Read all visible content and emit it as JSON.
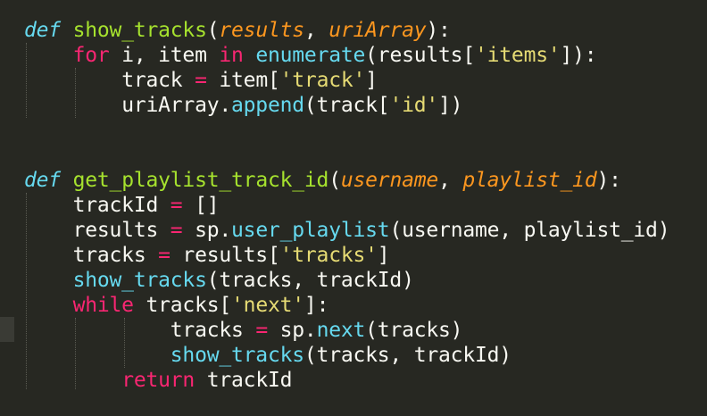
{
  "editor": {
    "language": "python",
    "theme": "monokai",
    "colors": {
      "background": "#272822",
      "keyword_def": "#66d9ef",
      "keyword_control": "#f92672",
      "function_name": "#a6e22e",
      "parameter": "#fd971f",
      "string": "#e6db74",
      "builtin_call": "#66d9ef",
      "plain": "#f8f8f2"
    },
    "lines": [
      {
        "indent": "",
        "tokens": [
          {
            "t": "def",
            "c": "kw"
          },
          {
            "t": " ",
            "c": "pl"
          },
          {
            "t": "show_tracks",
            "c": "fn"
          },
          {
            "t": "(",
            "c": "pl"
          },
          {
            "t": "results",
            "c": "par"
          },
          {
            "t": ", ",
            "c": "pl"
          },
          {
            "t": "uriArray",
            "c": "par"
          },
          {
            "t": "):",
            "c": "pl"
          }
        ]
      },
      {
        "indent": "    ",
        "tokens": [
          {
            "t": "for",
            "c": "ctl"
          },
          {
            "t": " i, item ",
            "c": "pl"
          },
          {
            "t": "in",
            "c": "ctl"
          },
          {
            "t": " ",
            "c": "pl"
          },
          {
            "t": "enumerate",
            "c": "bi"
          },
          {
            "t": "(results[",
            "c": "pl"
          },
          {
            "t": "'items'",
            "c": "str"
          },
          {
            "t": "]):",
            "c": "pl"
          }
        ]
      },
      {
        "indent": "        ",
        "tokens": [
          {
            "t": "track ",
            "c": "pl"
          },
          {
            "t": "=",
            "c": "op"
          },
          {
            "t": " item[",
            "c": "pl"
          },
          {
            "t": "'track'",
            "c": "str"
          },
          {
            "t": "]",
            "c": "pl"
          }
        ]
      },
      {
        "indent": "        ",
        "tokens": [
          {
            "t": "uriArray.",
            "c": "pl"
          },
          {
            "t": "append",
            "c": "bi"
          },
          {
            "t": "(track[",
            "c": "pl"
          },
          {
            "t": "'id'",
            "c": "str"
          },
          {
            "t": "])",
            "c": "pl"
          }
        ]
      },
      {
        "indent": "",
        "tokens": []
      },
      {
        "indent": "",
        "tokens": []
      },
      {
        "indent": "",
        "tokens": [
          {
            "t": "def",
            "c": "kw"
          },
          {
            "t": " ",
            "c": "pl"
          },
          {
            "t": "get_playlist_track_id",
            "c": "fn"
          },
          {
            "t": "(",
            "c": "pl"
          },
          {
            "t": "username",
            "c": "par"
          },
          {
            "t": ", ",
            "c": "pl"
          },
          {
            "t": "playlist_id",
            "c": "par"
          },
          {
            "t": "):",
            "c": "pl"
          }
        ]
      },
      {
        "indent": "    ",
        "tokens": [
          {
            "t": "trackId ",
            "c": "pl"
          },
          {
            "t": "=",
            "c": "op"
          },
          {
            "t": " []",
            "c": "pl"
          }
        ]
      },
      {
        "indent": "    ",
        "tokens": [
          {
            "t": "results ",
            "c": "pl"
          },
          {
            "t": "=",
            "c": "op"
          },
          {
            "t": " sp.",
            "c": "pl"
          },
          {
            "t": "user_playlist",
            "c": "bi"
          },
          {
            "t": "(username, playlist_id)",
            "c": "pl"
          }
        ]
      },
      {
        "indent": "    ",
        "tokens": [
          {
            "t": "tracks ",
            "c": "pl"
          },
          {
            "t": "=",
            "c": "op"
          },
          {
            "t": " results[",
            "c": "pl"
          },
          {
            "t": "'tracks'",
            "c": "str"
          },
          {
            "t": "]",
            "c": "pl"
          }
        ]
      },
      {
        "indent": "    ",
        "tokens": [
          {
            "t": "show_tracks",
            "c": "bi"
          },
          {
            "t": "(tracks, trackId)",
            "c": "pl"
          }
        ]
      },
      {
        "indent": "    ",
        "tokens": [
          {
            "t": "while",
            "c": "ctl"
          },
          {
            "t": " tracks[",
            "c": "pl"
          },
          {
            "t": "'next'",
            "c": "str"
          },
          {
            "t": "]:",
            "c": "pl"
          }
        ]
      },
      {
        "indent": "            ",
        "tokens": [
          {
            "t": "tracks ",
            "c": "pl"
          },
          {
            "t": "=",
            "c": "op"
          },
          {
            "t": " sp.",
            "c": "pl"
          },
          {
            "t": "next",
            "c": "bi"
          },
          {
            "t": "(tracks)",
            "c": "pl"
          }
        ]
      },
      {
        "indent": "            ",
        "tokens": [
          {
            "t": "show_tracks",
            "c": "bi"
          },
          {
            "t": "(tracks, trackId)",
            "c": "pl"
          }
        ]
      },
      {
        "indent": "        ",
        "tokens": [
          {
            "t": "return",
            "c": "ctl"
          },
          {
            "t": " trackId",
            "c": "pl"
          }
        ]
      }
    ]
  }
}
